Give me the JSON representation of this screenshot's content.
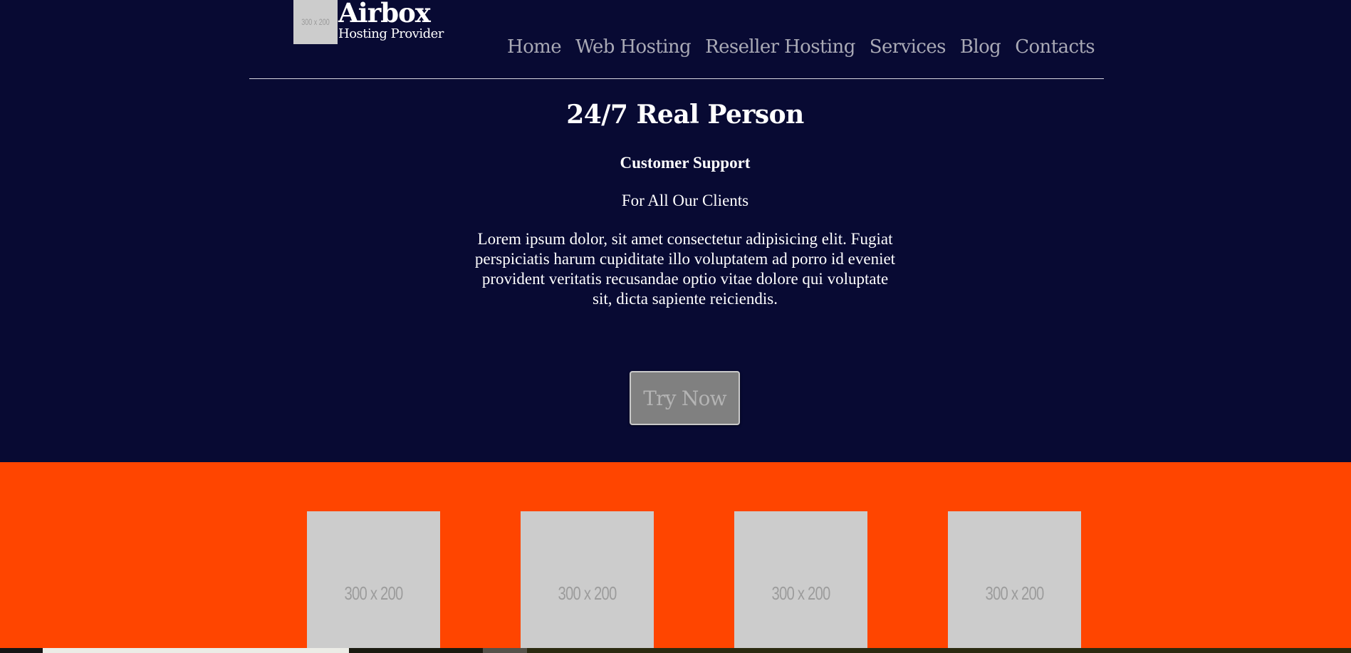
{
  "brand": {
    "logo_placeholder": "300 x 200",
    "name": "Airbox",
    "tagline": "Hosting Provider"
  },
  "nav": {
    "items": [
      "Home",
      "Web Hosting",
      "Reseller Hosting",
      "Services",
      "Blog",
      "Contacts"
    ]
  },
  "hero": {
    "title": "24/7 Real Person",
    "subtitle": "Customer Support",
    "tagline": "For All Our Clients",
    "body": "Lorem ipsum dolor, sit amet consectetur adipisicing elit. Fugiat perspiciatis harum cupiditate illo voluptatem ad porro id eveniet provident veritatis recusandae optio vitae dolore qui voluptate sit, dicta sapiente reiciendis.",
    "cta_label": "Try Now"
  },
  "features": {
    "thumbnails": [
      "300 x 200",
      "300 x 200",
      "300 x 200",
      "300 x 200"
    ]
  },
  "colors": {
    "background": "#080a33",
    "band": "#ff4500",
    "button": "#808080"
  }
}
